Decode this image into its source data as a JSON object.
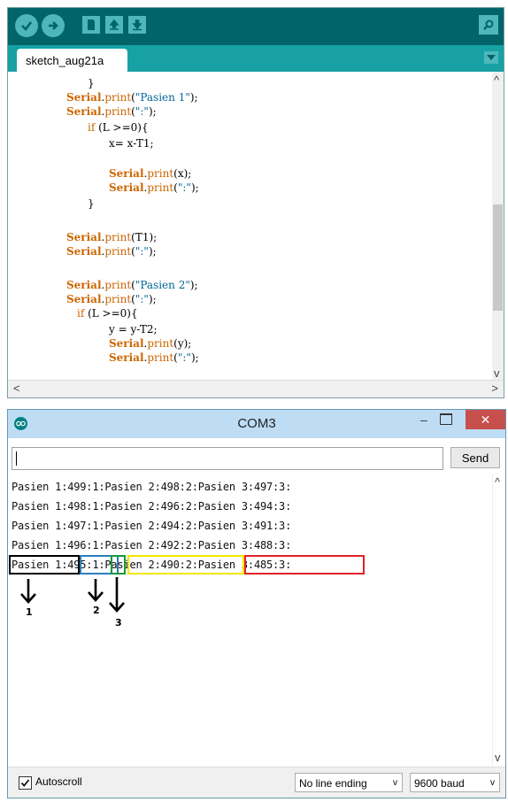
{
  "ide": {
    "toolbar": {
      "verify_icon": "check-icon",
      "upload_icon": "arrow-right-icon",
      "new_icon": "file-icon",
      "open_icon": "upload-icon",
      "save_icon": "download-icon",
      "monitor_icon": "magnifier-icon"
    },
    "tab_label": "sketch_aug21a",
    "code": [
      "}",
      "Serial.print(\"Pasien 1\");",
      "Serial.print(\":\");",
      "if (L >=0){",
      "x= x-T1;",
      "",
      "Serial.print(x);",
      "Serial.print(\":\");",
      "}",
      "",
      "Serial.print(T1);",
      "Serial.print(\":\");",
      "",
      "Serial.print(\"Pasien 2\");",
      "Serial.print(\":\");",
      "if (L >=0){",
      "y = y-T2;",
      "Serial.print(y);",
      "Serial.print(\":\");"
    ]
  },
  "monitor": {
    "title": "COM3",
    "minimize": "–",
    "close": "✕",
    "command_value": "",
    "send_label": "Send",
    "output": [
      "Pasien 1:499:1:Pasien 2:498:2:Pasien 3:497:3:",
      "Pasien 1:498:1:Pasien 2:496:2:Pasien 3:494:3:",
      "Pasien 1:497:1:Pasien 2:494:2:Pasien 3:491:3:",
      "Pasien 1:496:1:Pasien 2:492:2:Pasien 3:488:3:",
      "Pasien 1:495:1:Pasien 2:490:2:Pasien 3:485:3:"
    ],
    "annotations": [
      "1",
      "2",
      "3"
    ],
    "highlight_colors": [
      "#000000",
      "#2a7fbf",
      "#1a9a3a",
      "#f2e600",
      "#e0202a"
    ],
    "autoscroll_label": "Autoscroll",
    "autoscroll_checked": true,
    "line_ending": "No line ending",
    "baud": "9600 baud"
  }
}
